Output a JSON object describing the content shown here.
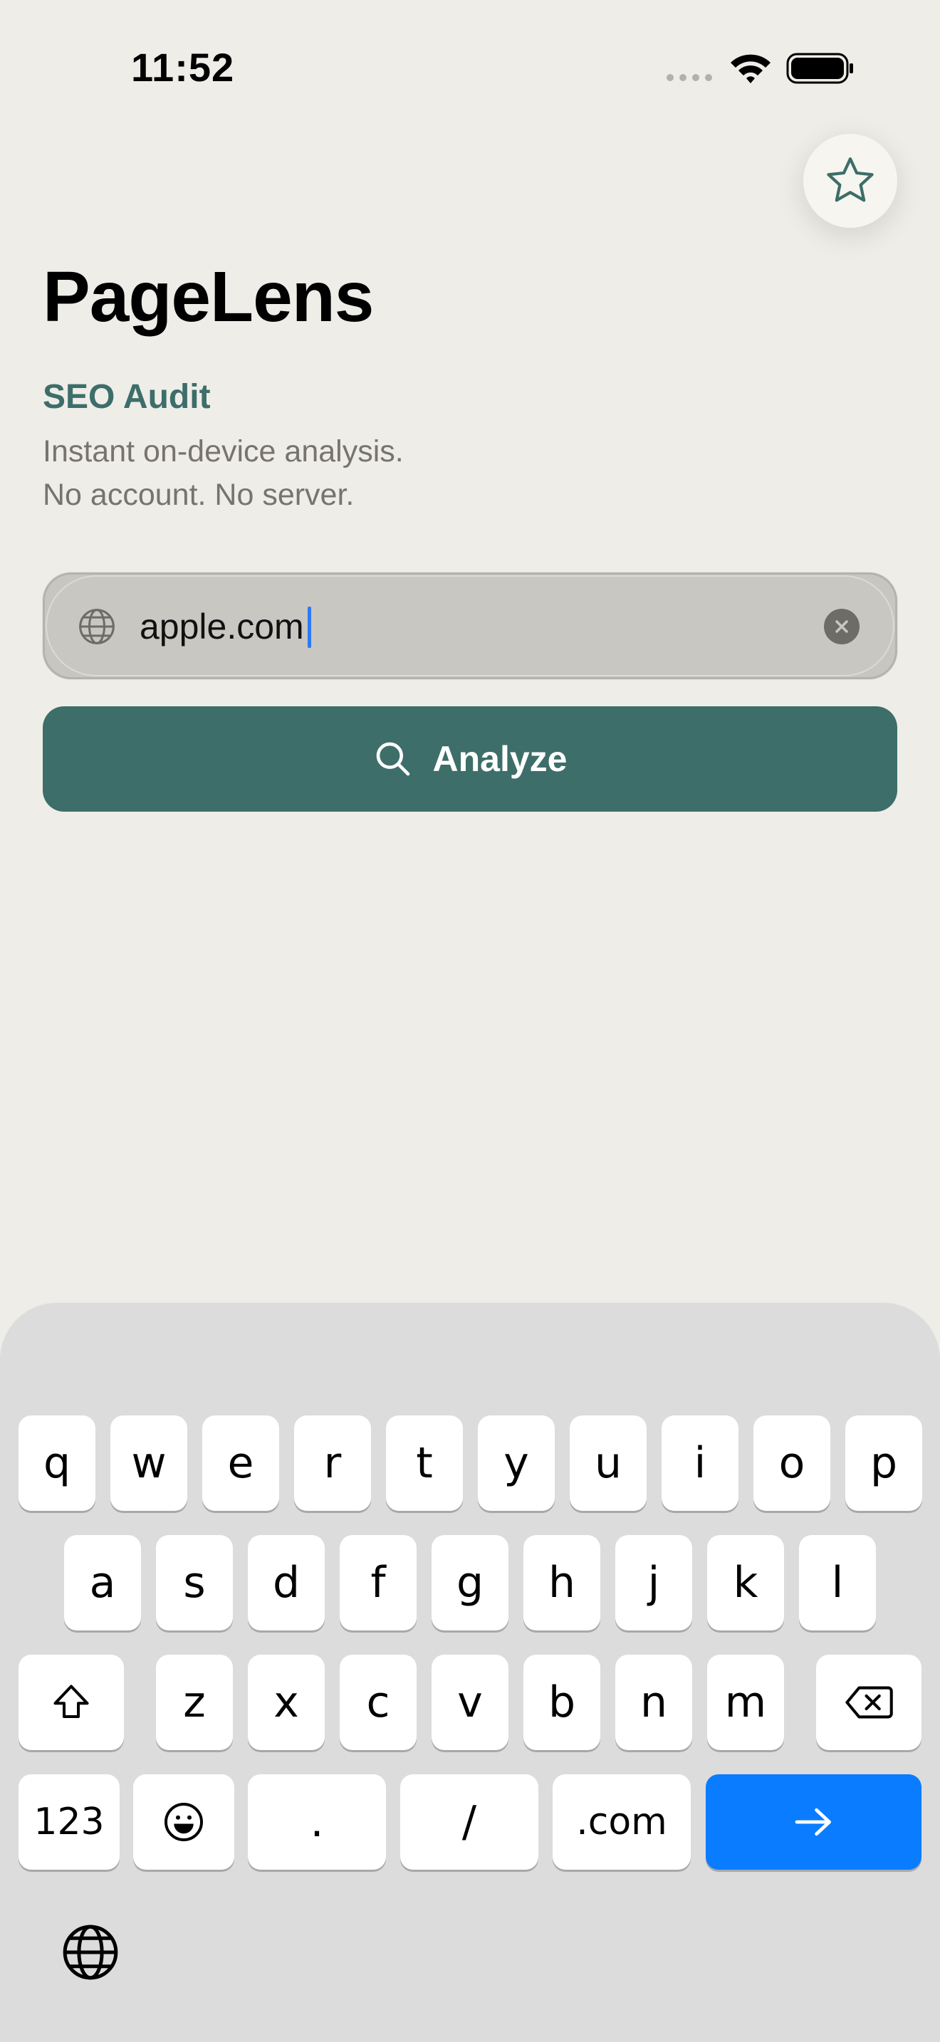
{
  "status_bar": {
    "time": "11:52"
  },
  "app": {
    "title": "PageLens",
    "subtitle": "SEO Audit",
    "description_line1": "Instant on-device analysis.",
    "description_line2": "No account. No server."
  },
  "url_field": {
    "value": "apple.com",
    "icon": "globe-icon",
    "clear_icon": "clear-icon"
  },
  "analyze_button": {
    "label": "Analyze",
    "icon": "search-icon"
  },
  "favorites_button": {
    "icon": "star-icon"
  },
  "keyboard": {
    "row1": [
      "q",
      "w",
      "e",
      "r",
      "t",
      "y",
      "u",
      "i",
      "o",
      "p"
    ],
    "row2": [
      "a",
      "s",
      "d",
      "f",
      "g",
      "h",
      "j",
      "k",
      "l"
    ],
    "row3": [
      "z",
      "x",
      "c",
      "v",
      "b",
      "n",
      "m"
    ],
    "numbers_key": "123",
    "dot_key": ".",
    "slash_key": "/",
    "dotcom_key": ".com",
    "go_key_icon": "arrow-right-icon"
  },
  "colors": {
    "accent": "#3d6e69",
    "go_key": "#0a7cff",
    "background": "#efede8"
  }
}
